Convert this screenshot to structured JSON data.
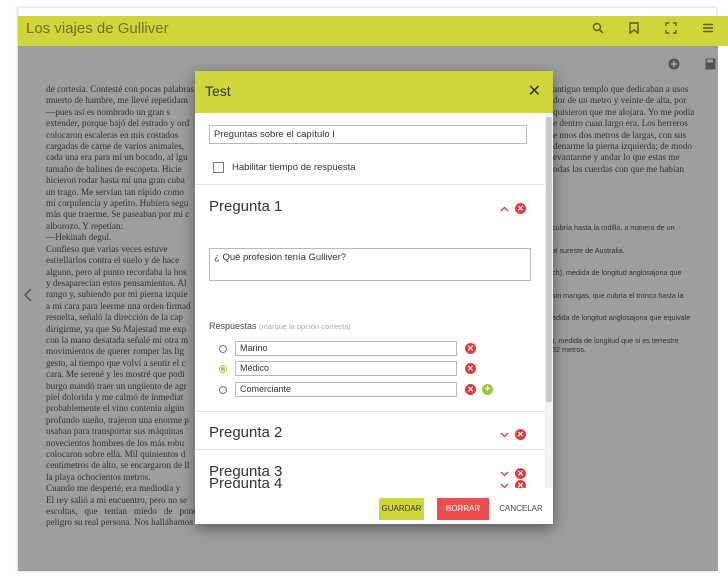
{
  "app": {
    "title": "Los viajes de Gulliver",
    "toolbar_icons": [
      "search-icon",
      "bookmark-icon",
      "fullscreen-icon",
      "menu-icon"
    ]
  },
  "background": {
    "left_lines": [
      "de cortesía. Contesté con pocas palabras",
      "muerto de hambre, me llevé repetidam",
      "—pues así es nombrado un gran s",
      "extender, porque bajó del estrado y ord",
      "colocaron escaleras en mis costados",
      "cargadas de carne de varios animales,",
      "cada una era para mí un bocado, al igu",
      "tamaño de balines de escopeta. Hicie",
      "hicieron rodar hasta mí una gran cuba",
      "un trago. Me servían tan rápido como",
      "mi corpulencia y apetito. Hubiera segu",
      "más que traerme. Se paseaban por mi c",
      "alborozo. Y repetían:",
      "—Hekinah degul.",
      "Confieso que varias veces estuve",
      "estrellarlos contra el suelo y de hace",
      "alguno, pero al punto recordaba la hos",
      "y desaparecían estos pensamientos. Al",
      "rango y, subiendo por mi pierna izquie",
      "a mi cara para leerme una orden firmad",
      "resuelta, señaló la dirección de la cap",
      "dirigirme, ya que Su Majestad me exp",
      "con la mano desatada señalé mi otra m",
      "movimientos de querer romper las lig",
      "gesto, al tiempo que volví a sentir el c",
      "cara. Me serené y les mostré que podí",
      "burgo mandó traer un ungüento de agr",
      "piel dolorida y me calmó de inmediat",
      "probablemente el vino contenía algún",
      "profundo sueño, trajeron una enorme p",
      "usaban para transportar sus máquinas",
      "novecientos hombres de los más robu",
      "colocaron sobre ella. Mil quinientos d",
      "centímetros de alto, se encargaron de ll",
      "la playa ochocientos metros.",
      "Cuando me desperté, era mediodía y",
      "El rey salió a mi encuentro, pero no se",
      "escoltas, que tenían miedo de poner en peligro su real persona. Nos hallábamos"
    ],
    "right_lines": [
      "antiguo templo que dedicaban a usos",
      "dor de un metro y veinte de alta, por",
      "quisieron que me alojara. Yo me podía",
      "e dentro cuan largo era. Los herreros",
      "e unos dos metros de largas, con sus",
      "denarme la pierna izquierda; de modo",
      "evantarme y andar lo que estas me",
      "odas las cuerdas con que me habían"
    ],
    "right_notes": [
      "cubría hasta la rodilla, a manera de un",
      "al sureste de Australia.",
      "ch), medida de longitud anglosajona que",
      "sin mangas, que cubría el tronco hasta la",
      "edida de longitud anglosajona que equivale",
      "), medida de longitud que si es terrestre\n52 metros."
    ]
  },
  "dialog": {
    "title": "Test",
    "close_icon": "close-icon",
    "test_title_value": "Preguntas sobre el capítulo I",
    "timer_label": "Habilitar tiempo de respuesta",
    "timer_checked": false,
    "questions": [
      {
        "label": "Pregunta 1",
        "expanded": true,
        "text": "¿ Qué profesión tenía Gulliver?",
        "answers_label": "Respuestas",
        "answers_hint": "(marque la opción correcta)",
        "answers": [
          {
            "value": "Marino",
            "correct": false
          },
          {
            "value": "Médico",
            "correct": true
          },
          {
            "value": "Comerciante",
            "correct": false
          }
        ]
      },
      {
        "label": "Pregunta 2",
        "expanded": false
      },
      {
        "label": "Pregunta 3",
        "expanded": false
      },
      {
        "label": "Pregunta 4",
        "expanded": false
      }
    ],
    "buttons": {
      "save": "GUARDAR",
      "delete": "BORRAR",
      "cancel": "CANCELAR"
    }
  },
  "colors": {
    "accent": "#cfd63a",
    "danger": "#e23c3c",
    "add": "#97c93a"
  }
}
